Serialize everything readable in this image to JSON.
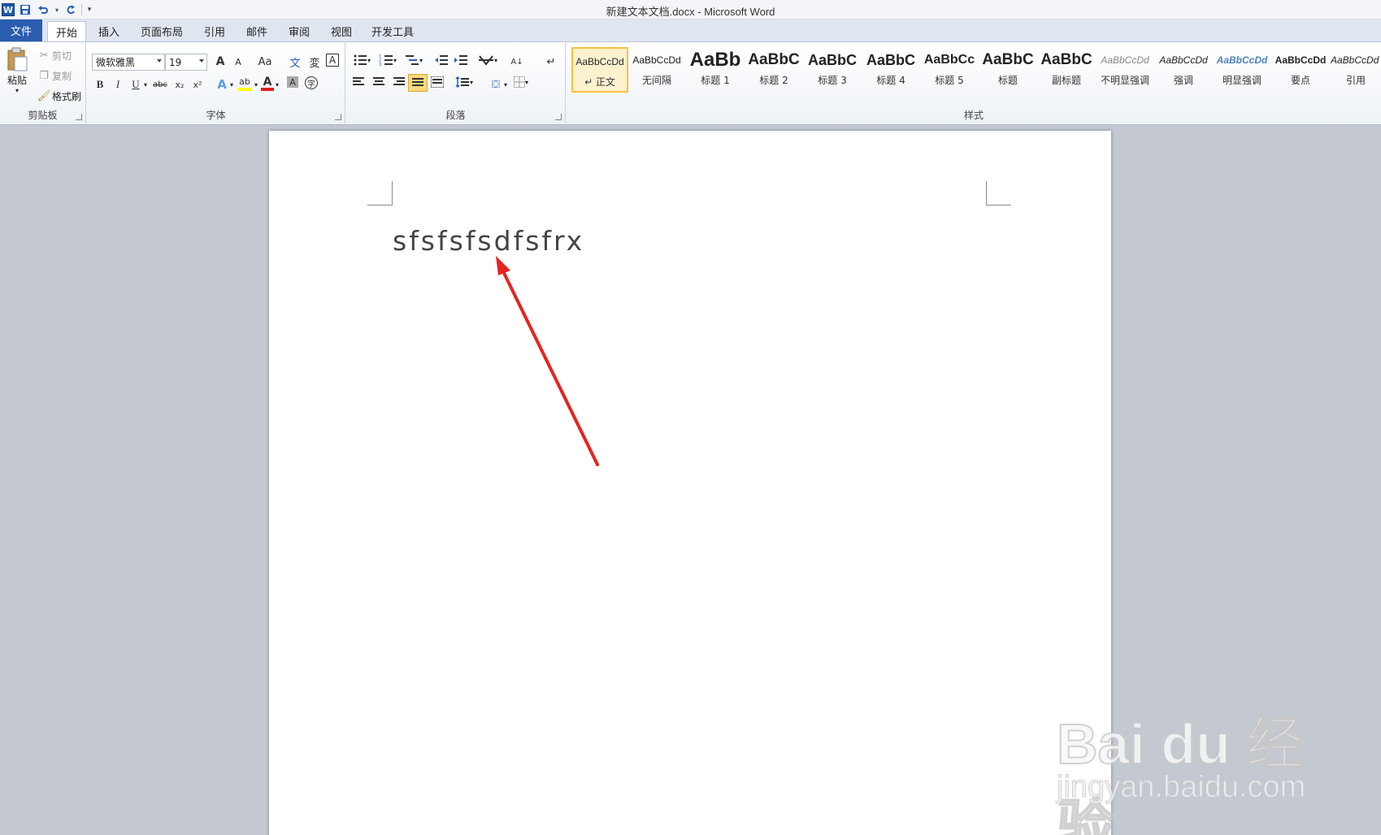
{
  "window": {
    "title": "新建文本文档.docx - Microsoft Word",
    "app_logo": "W"
  },
  "quick_access": {
    "save_icon": "save-icon",
    "undo_icon": "undo-icon",
    "redo_icon": "redo-icon",
    "customize_icon": "customize-icon"
  },
  "tabs": [
    {
      "label": "文件"
    },
    {
      "label": "开始"
    },
    {
      "label": "插入"
    },
    {
      "label": "页面布局"
    },
    {
      "label": "引用"
    },
    {
      "label": "邮件"
    },
    {
      "label": "审阅"
    },
    {
      "label": "视图"
    },
    {
      "label": "开发工具"
    }
  ],
  "clipboard": {
    "group_label": "剪贴板",
    "paste": "粘贴",
    "cut": "剪切",
    "copy": "复制",
    "format_painter": "格式刷"
  },
  "font": {
    "group_label": "字体",
    "font_name": "微软雅黑",
    "font_size": "19",
    "grow": "A",
    "shrink": "A",
    "case": "Aa",
    "bold": "B",
    "italic": "I",
    "underline": "U",
    "strike": "abc",
    "subscript": "x₂",
    "superscript": "x²",
    "color_sample": "A",
    "highlight_sample": "ab"
  },
  "paragraph": {
    "group_label": "段落"
  },
  "styles": {
    "group_label": "样式",
    "items": [
      {
        "sample": "AaBbCcDd",
        "name": "↵ 正文"
      },
      {
        "sample": "AaBbCcDd",
        "name": "无间隔"
      },
      {
        "sample": "AaBb",
        "name": "标题 1"
      },
      {
        "sample": "AaBbC",
        "name": "标题 2"
      },
      {
        "sample": "AaBbC",
        "name": "标题 3"
      },
      {
        "sample": "AaBbC",
        "name": "标题 4"
      },
      {
        "sample": "AaBbCc",
        "name": "标题 5"
      },
      {
        "sample": "AaBbC",
        "name": "标题"
      },
      {
        "sample": "AaBbC",
        "name": "副标题"
      },
      {
        "sample": "AaBbCcDd",
        "name": "不明显强调"
      },
      {
        "sample": "AaBbCcDd",
        "name": "强调"
      },
      {
        "sample": "AaBbCcDd",
        "name": "明显强调"
      },
      {
        "sample": "AaBbCcDd",
        "name": "要点"
      },
      {
        "sample": "AaBbCcDd",
        "name": "引用"
      }
    ]
  },
  "document": {
    "text": "sfsfsfsdfsfrx"
  },
  "annotation": {
    "arrow_color": "#e8231f"
  },
  "watermark": {
    "logo": "Bai du 经验",
    "url": "jingyan.baidu.com"
  },
  "colors": {
    "file_tab": "#2a5cb0",
    "selected_style": "#f3c244",
    "font_color_bar": "#e0201b",
    "highlight_bar": "#ffff00"
  }
}
